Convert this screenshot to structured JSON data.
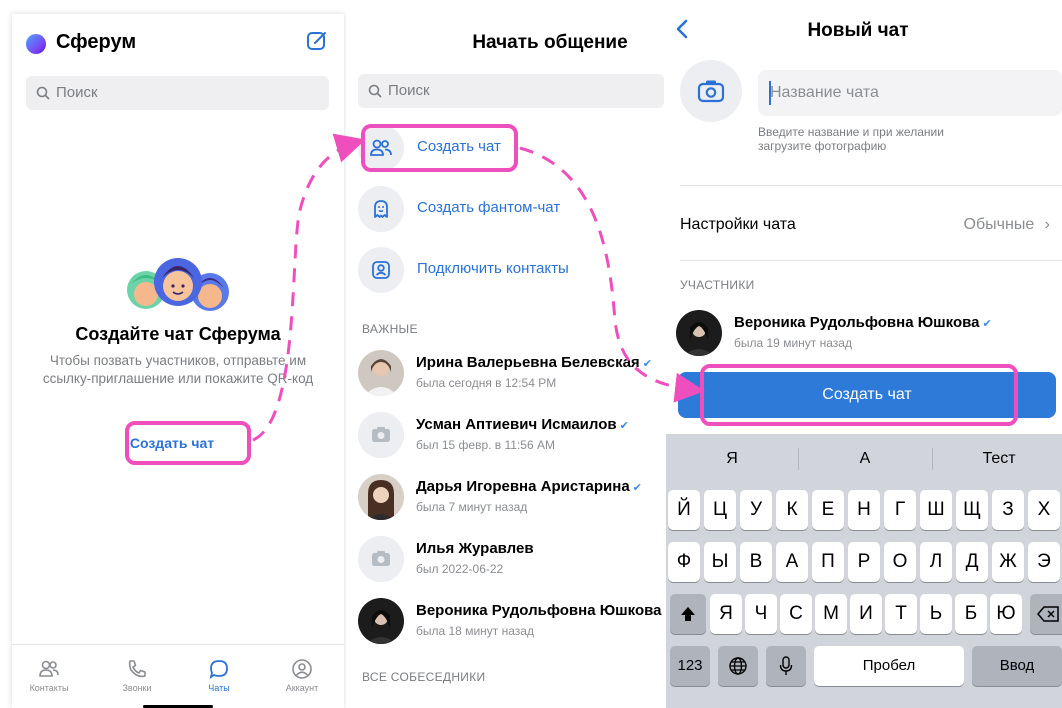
{
  "colors": {
    "accent": "#2a72d6",
    "highlight": "#ee4fbd",
    "button": "#2d7ad8"
  },
  "screen1": {
    "app_title": "Сферум",
    "search_placeholder": "Поиск",
    "empty_title": "Создайте чат Сферума",
    "empty_text": "Чтобы позвать участников, отправьте им ссылку-приглашение или покажите QR-код",
    "create_link": "Создать чат",
    "tabs": [
      {
        "label": "Контакты",
        "icon": "contacts-icon"
      },
      {
        "label": "Звонки",
        "icon": "phone-icon"
      },
      {
        "label": "Чаты",
        "icon": "chat-icon",
        "active": true
      },
      {
        "label": "Аккаунт",
        "icon": "account-icon"
      }
    ]
  },
  "screen2": {
    "title": "Начать общение",
    "search_placeholder": "Поиск",
    "actions": [
      {
        "label": "Создать чат",
        "icon": "users-icon"
      },
      {
        "label": "Создать фантом-чат",
        "icon": "ghost-icon"
      },
      {
        "label": "Подключить контакты",
        "icon": "contact-card-icon"
      }
    ],
    "section_important": "ВАЖНЫЕ",
    "contacts": [
      {
        "name": "Ирина Валерьевна Белевская",
        "status": "была сегодня в 12:54 PM",
        "verified": true
      },
      {
        "name": "Усман Аптиевич Исмаилов",
        "status": "был 15 февр. в 11:56 AM",
        "verified": true
      },
      {
        "name": "Дарья Игоревна Аристарина",
        "status": "была 7 минут назад",
        "verified": true
      },
      {
        "name": "Илья Журавлев",
        "status": "был 2022-06-22",
        "verified": false
      },
      {
        "name": "Вероника Рудольфовна Юшкова",
        "status": "была 18 минут назад",
        "verified": false
      }
    ],
    "section_all": "ВСЕ СОБЕСЕДНИКИ"
  },
  "screen3": {
    "title": "Новый чат",
    "name_placeholder": "Название чата",
    "hint": "Введите название и при желании загрузите фотографию",
    "settings_label": "Настройки чата",
    "settings_value": "Обычные",
    "section_members": "УЧАСТНИКИ",
    "member": {
      "name": "Вероника Рудольфовна Юшкова",
      "status": "была 19 минут назад",
      "verified": true
    },
    "create_button": "Создать чат",
    "keyboard": {
      "suggestions": [
        "Я",
        "А",
        "Тест"
      ],
      "row1": [
        "Й",
        "Ц",
        "У",
        "К",
        "Е",
        "Н",
        "Г",
        "Ш",
        "Щ",
        "З",
        "Х"
      ],
      "row2": [
        "Ф",
        "Ы",
        "В",
        "А",
        "П",
        "Р",
        "О",
        "Л",
        "Д",
        "Ж",
        "Э"
      ],
      "row3": [
        "Я",
        "Ч",
        "С",
        "М",
        "И",
        "Т",
        "Ь",
        "Б",
        "Ю"
      ],
      "numbers_key": "123",
      "space_key": "Пробел",
      "enter_key": "Ввод"
    }
  }
}
